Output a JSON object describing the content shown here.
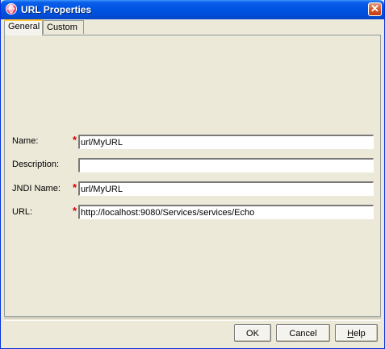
{
  "window": {
    "title": "URL Properties"
  },
  "tabs": [
    {
      "label": "General",
      "active": true
    },
    {
      "label": "Custom",
      "active": false
    }
  ],
  "form": {
    "required_marker": "*",
    "fields": [
      {
        "label": "Name:",
        "value": "url/MyURL",
        "required": true
      },
      {
        "label": "Description:",
        "value": "",
        "required": false
      },
      {
        "label": "JNDI Name:",
        "value": "url/MyURL",
        "required": true
      },
      {
        "label": "URL:",
        "value": "http://localhost:9080/Services/services/Echo",
        "required": true
      }
    ]
  },
  "buttons": {
    "ok": "OK",
    "cancel": "Cancel",
    "help_mnemonic": "H",
    "help_rest": "elp"
  },
  "colors": {
    "title_bar": "#0054e3",
    "required": "#d40000",
    "dialog_bg": "#ece9d8"
  }
}
